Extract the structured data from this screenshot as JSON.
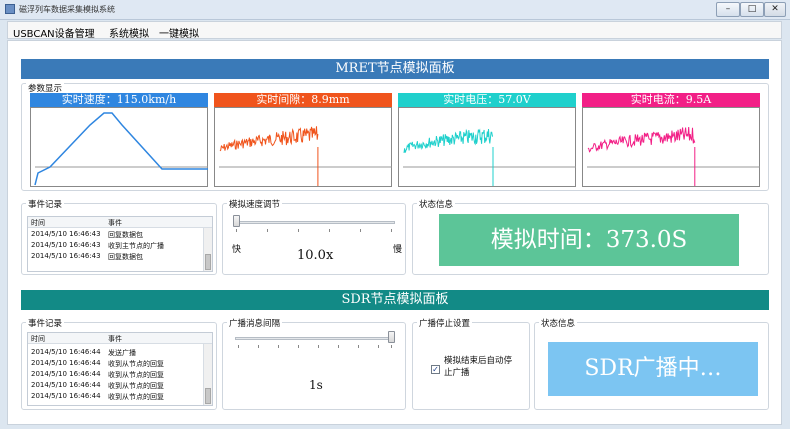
{
  "window": {
    "title": "磁浮列车数据采集模拟系统",
    "min": "–",
    "max": "□",
    "close": "✕"
  },
  "menu": [
    "USBCAN设备管理",
    "系统模拟",
    "一键模拟"
  ],
  "mret": {
    "header": "MRET节点模拟面板",
    "params_label": "参数显示",
    "gauges": [
      {
        "title": "实时速度：115.0km/h",
        "color": "#2f86e0",
        "line": "#2f86e0"
      },
      {
        "title": "实时间隙：8.9mm",
        "color": "#f0541c",
        "line": "#f0541c"
      },
      {
        "title": "实时电压：57.0V",
        "color": "#1fd0cc",
        "line": "#1fd0cc"
      },
      {
        "title": "实时电流：9.5A",
        "color": "#f21f86",
        "line": "#f21f86"
      }
    ],
    "log": {
      "label": "事件记录",
      "col_time": "时间",
      "col_event": "事件",
      "rows": [
        {
          "time": "2014/5/10 16:46:43",
          "event": "回复数据包"
        },
        {
          "time": "2014/5/10 16:46:43",
          "event": "收到主节点的广播"
        },
        {
          "time": "2014/5/10 16:46:43",
          "event": "回复数据包"
        }
      ]
    },
    "speed": {
      "label": "模拟速度调节",
      "slow": "快",
      "fast": "慢",
      "value": "10.0x",
      "level": 0
    },
    "status": {
      "label": "状态信息",
      "text": "模拟时间：373.0S",
      "color": "#5cc598"
    }
  },
  "sdr": {
    "header": "SDR节点模拟面板",
    "log": {
      "label": "事件记录",
      "col_time": "时间",
      "col_event": "事件",
      "rows": [
        {
          "time": "2014/5/10 16:46:44",
          "event": "发送广播"
        },
        {
          "time": "2014/5/10 16:46:44",
          "event": "收到从节点的回复"
        },
        {
          "time": "2014/5/10 16:46:44",
          "event": "收到从节点的回复"
        },
        {
          "time": "2014/5/10 16:46:44",
          "event": "收到从节点的回复"
        },
        {
          "time": "2014/5/10 16:46:44",
          "event": "收到从节点的回复"
        }
      ]
    },
    "interval": {
      "label": "广播消息间隔",
      "value": "1s",
      "level": 1
    },
    "stop": {
      "label": "广播停止设置",
      "checkbox_text": "模拟结束后自动停止广播",
      "checked": true,
      "check_glyph": "✓"
    },
    "status": {
      "label": "状态信息",
      "text": "SDR广播中…",
      "color": "#7cc5f2"
    }
  }
}
